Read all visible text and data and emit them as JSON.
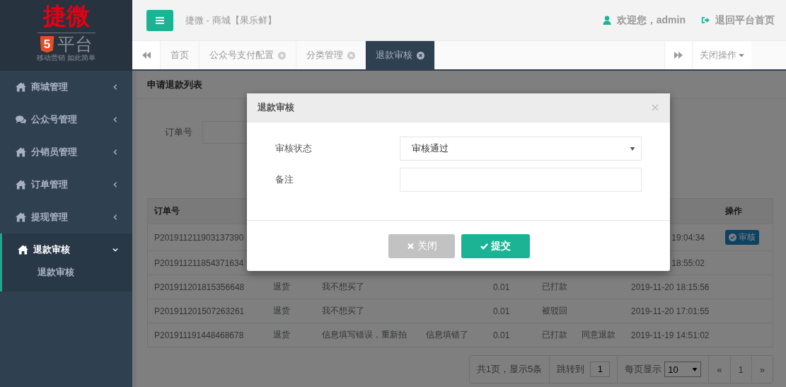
{
  "logo": {
    "title": "捷微",
    "badge": "5",
    "subtitle": "平台",
    "slogan": "移动营销 如此简单"
  },
  "sidebar": {
    "items": [
      {
        "label": "商城管理",
        "kind": "home",
        "expanded": false,
        "selected": false
      },
      {
        "label": "公众号管理",
        "kind": "chat",
        "expanded": false,
        "selected": false
      },
      {
        "label": "分销员管理",
        "kind": "home",
        "expanded": false,
        "selected": false
      },
      {
        "label": "订单管理",
        "kind": "home",
        "expanded": false,
        "selected": false
      },
      {
        "label": "提现管理",
        "kind": "home",
        "expanded": false,
        "selected": false
      },
      {
        "label": "退款审核",
        "kind": "home",
        "expanded": true,
        "selected": true,
        "children": [
          {
            "label": "退款审核"
          }
        ]
      }
    ]
  },
  "header": {
    "title": "捷微 - 商城【果乐鲜】",
    "user": "欢迎您，admin",
    "home_link": "退回平台首页"
  },
  "tabs": [
    {
      "label": "首页",
      "closable": false,
      "selected": false
    },
    {
      "label": "公众号支付配置",
      "closable": true,
      "selected": false
    },
    {
      "label": "分类管理",
      "closable": true,
      "selected": false
    },
    {
      "label": "退款审核",
      "closable": true,
      "selected": true
    }
  ],
  "tab_menu": "关闭操作",
  "panel": {
    "title": "申请退款列表",
    "filter_label": "订单号"
  },
  "table": {
    "columns": [
      {
        "label": "订单号"
      },
      {
        "label": "操作"
      }
    ],
    "rows": [
      {
        "order_no": "P201911211903137390",
        "time": "19:04:34",
        "action": "审核"
      },
      {
        "order_no": "P201911211854371634",
        "time": "18:55:02"
      },
      {
        "order_no": "P201911201815356648",
        "type": "退货",
        "reason": "我不想买了",
        "amount": "0.01",
        "status": "已打款",
        "time": "2019-11-20 18:15:56"
      },
      {
        "order_no": "P201911201507263261",
        "type": "退货",
        "reason": "我不想买了",
        "amount": "0.01",
        "status": "被驳回",
        "time": "2019-11-20 17:01:55"
      },
      {
        "order_no": "P201911191448468678",
        "type": "退货",
        "reason": "信息填写错误，重新拍",
        "remark": "信息填错了",
        "amount": "0.01",
        "status": "已打款",
        "note": "同意退款",
        "time": "2019-11-19 14:51:02"
      }
    ]
  },
  "pagination": {
    "summary": "共1页，显示5条",
    "jump_label": "跳转到",
    "jump_value": "1",
    "size_label": "每页显示",
    "size_value": "10",
    "prev": "«",
    "page": "1",
    "next": "»"
  },
  "modal": {
    "title": "退款审核",
    "fields": [
      {
        "label": "审核状态",
        "kind": "select",
        "value": "审核通过"
      },
      {
        "label": "备注",
        "kind": "text"
      }
    ],
    "buttons": [
      {
        "label": "关闭",
        "kind": "cancel"
      },
      {
        "label": "提交",
        "kind": "submit"
      }
    ]
  }
}
